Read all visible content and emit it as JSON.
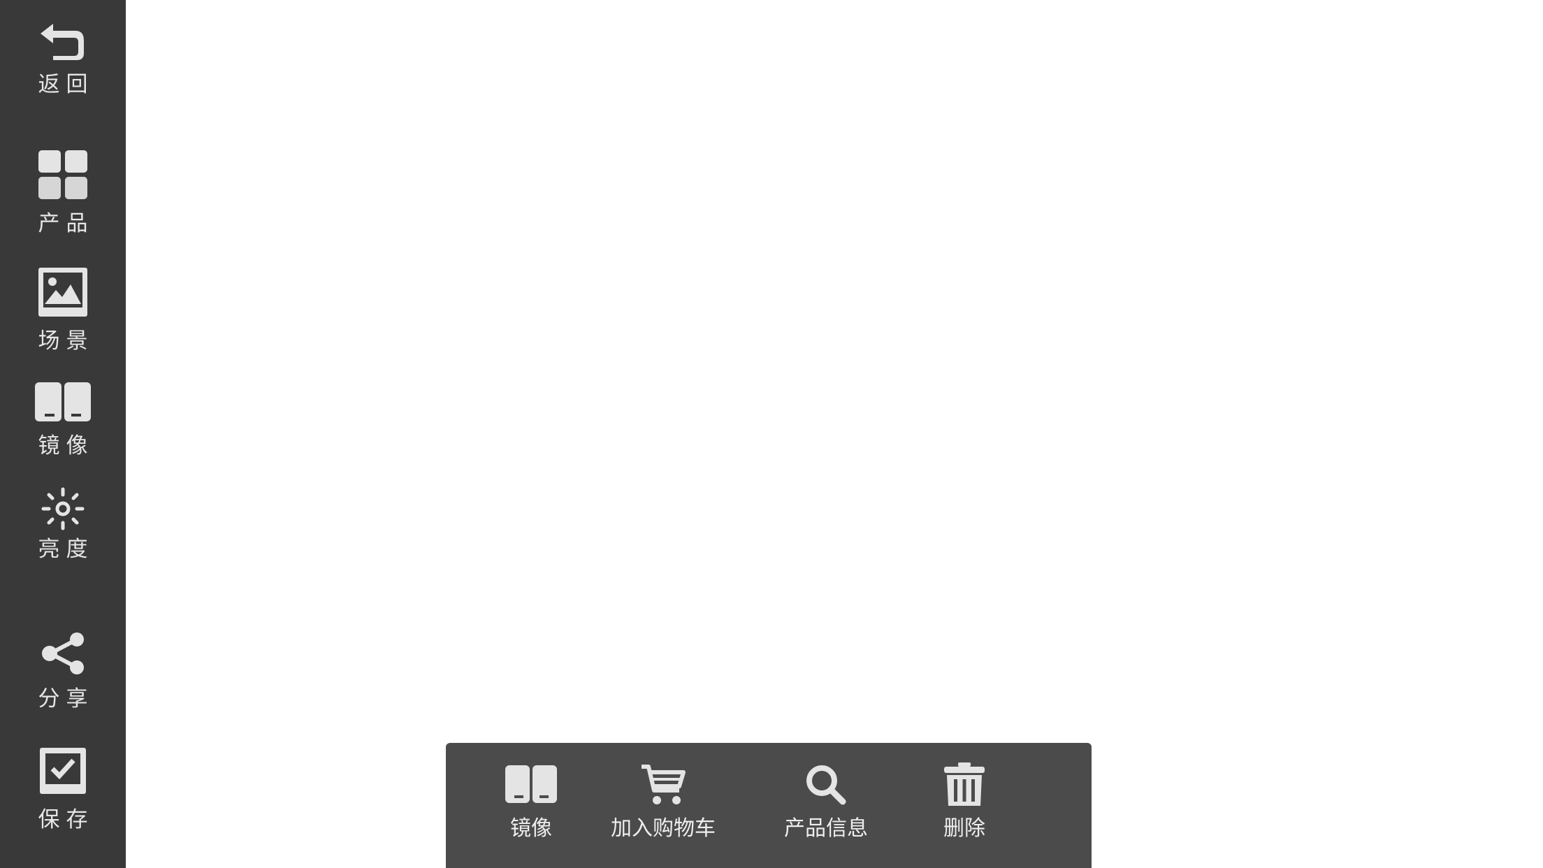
{
  "sidebar": {
    "items": [
      {
        "id": "back",
        "label": "返回",
        "icon": "back-arrow-icon"
      },
      {
        "id": "product",
        "label": "产品",
        "icon": "grid-icon"
      },
      {
        "id": "scene",
        "label": "场景",
        "icon": "image-icon"
      },
      {
        "id": "mirror",
        "label": "镜像",
        "icon": "mirror-icon"
      },
      {
        "id": "brightness",
        "label": "亮度",
        "icon": "sun-icon"
      },
      {
        "id": "share",
        "label": "分享",
        "icon": "share-icon"
      },
      {
        "id": "save",
        "label": "保存",
        "icon": "checkbox-icon"
      }
    ]
  },
  "toolbar": {
    "items": [
      {
        "id": "mirror",
        "label": "镜像",
        "icon": "mirror-icon"
      },
      {
        "id": "add_to_cart",
        "label": "加入购物车",
        "icon": "cart-icon"
      },
      {
        "id": "product_info",
        "label": "产品信息",
        "icon": "search-icon"
      },
      {
        "id": "delete",
        "label": "删除",
        "icon": "trash-icon"
      }
    ]
  },
  "colors": {
    "sidebar_bg": "#393939",
    "toolbar_bg": "#4b4b4b",
    "icon": "#e0e0e0",
    "canvas_bg": "#ffffff"
  }
}
